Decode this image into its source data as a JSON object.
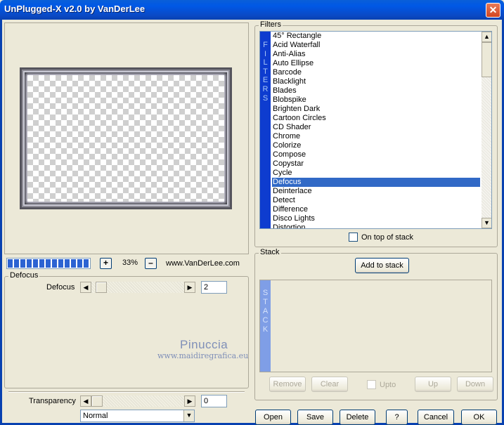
{
  "window": {
    "title": "UnPlugged-X v2.0 by VanDerLee",
    "close_glyph": "✕"
  },
  "preview": {
    "progress_percent": 100,
    "zoom": "33%",
    "zoom_in_glyph": "+",
    "zoom_out_glyph": "–",
    "website": "www.VanDerLee.com"
  },
  "defocus_group": {
    "label": "Defocus",
    "param_label": "Defocus",
    "param_value": "2",
    "slider_left": "◀",
    "slider_right": "▶"
  },
  "watermark": {
    "line1": "Pinuccia",
    "line2": "www.maidiregrafica.eu"
  },
  "transparency": {
    "label": "Transparency",
    "value": "0"
  },
  "blend_mode": {
    "selected": "Normal",
    "dropdown_glyph": "▼"
  },
  "filters": {
    "label": "Filters",
    "side_text": [
      "F",
      "I",
      "L",
      "T",
      "E",
      "R",
      "S"
    ],
    "items": [
      "45° Rectangle",
      "Acid Waterfall",
      "Anti-Alias",
      "Auto Ellipse",
      "Barcode",
      "Blacklight",
      "Blades",
      "Blobspike",
      "Brighten Dark",
      "Cartoon Circles",
      "CD Shader",
      "Chrome",
      "Colorize",
      "Compose",
      "Copystar",
      "Cycle",
      "Defocus",
      "Deinterlace",
      "Detect",
      "Difference",
      "Disco Lights",
      "Distortion"
    ],
    "selected_index": 16,
    "scroll_up": "▲",
    "scroll_down": "▼",
    "on_top_label": "On top of stack"
  },
  "stack": {
    "label": "Stack",
    "add_button": "Add to stack",
    "side_text": [
      "S",
      "T",
      "A",
      "C",
      "K"
    ],
    "remove": "Remove",
    "clear": "Clear",
    "upto": "Upto",
    "up": "Up",
    "down": "Down"
  },
  "footer": {
    "open": "Open",
    "save": "Save",
    "delete": "Delete",
    "help": "?",
    "cancel": "Cancel",
    "ok": "OK"
  },
  "colors": {
    "title_blue": "#0058e6",
    "selection": "#3169c6",
    "filters_side": "#0e3ccf",
    "stack_side": "#7f9ee6"
  }
}
